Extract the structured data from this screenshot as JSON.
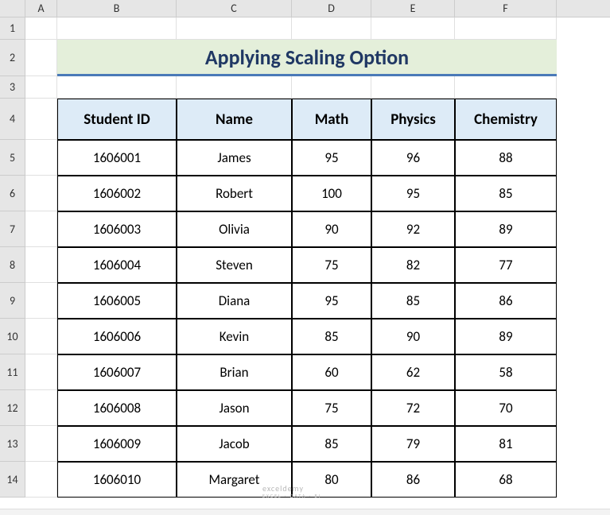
{
  "columns": [
    "A",
    "B",
    "C",
    "D",
    "E",
    "F"
  ],
  "row_numbers": [
    "1",
    "2",
    "3",
    "4",
    "5",
    "6",
    "7",
    "8",
    "9",
    "10",
    "11",
    "12",
    "13",
    "14"
  ],
  "title": "Applying Scaling Option",
  "table": {
    "headers": [
      "Student ID",
      "Name",
      "Math",
      "Physics",
      "Chemistry"
    ],
    "rows": [
      {
        "id": "1606001",
        "name": "James",
        "math": "95",
        "physics": "96",
        "chem": "88"
      },
      {
        "id": "1606002",
        "name": "Robert",
        "math": "100",
        "physics": "95",
        "chem": "85"
      },
      {
        "id": "1606003",
        "name": "Olivia",
        "math": "90",
        "physics": "92",
        "chem": "89"
      },
      {
        "id": "1606004",
        "name": "Steven",
        "math": "75",
        "physics": "82",
        "chem": "77"
      },
      {
        "id": "1606005",
        "name": "Diana",
        "math": "95",
        "physics": "85",
        "chem": "86"
      },
      {
        "id": "1606006",
        "name": "Kevin",
        "math": "85",
        "physics": "90",
        "chem": "89"
      },
      {
        "id": "1606007",
        "name": "Brian",
        "math": "60",
        "physics": "62",
        "chem": "58"
      },
      {
        "id": "1606008",
        "name": "Jason",
        "math": "75",
        "physics": "72",
        "chem": "70"
      },
      {
        "id": "1606009",
        "name": "Jacob",
        "math": "85",
        "physics": "79",
        "chem": "81"
      },
      {
        "id": "1606010",
        "name": "Margaret",
        "math": "80",
        "physics": "86",
        "chem": "68"
      }
    ]
  },
  "watermark": {
    "main": "exceldemy",
    "sub": "EXCEL · DATA · BI"
  }
}
